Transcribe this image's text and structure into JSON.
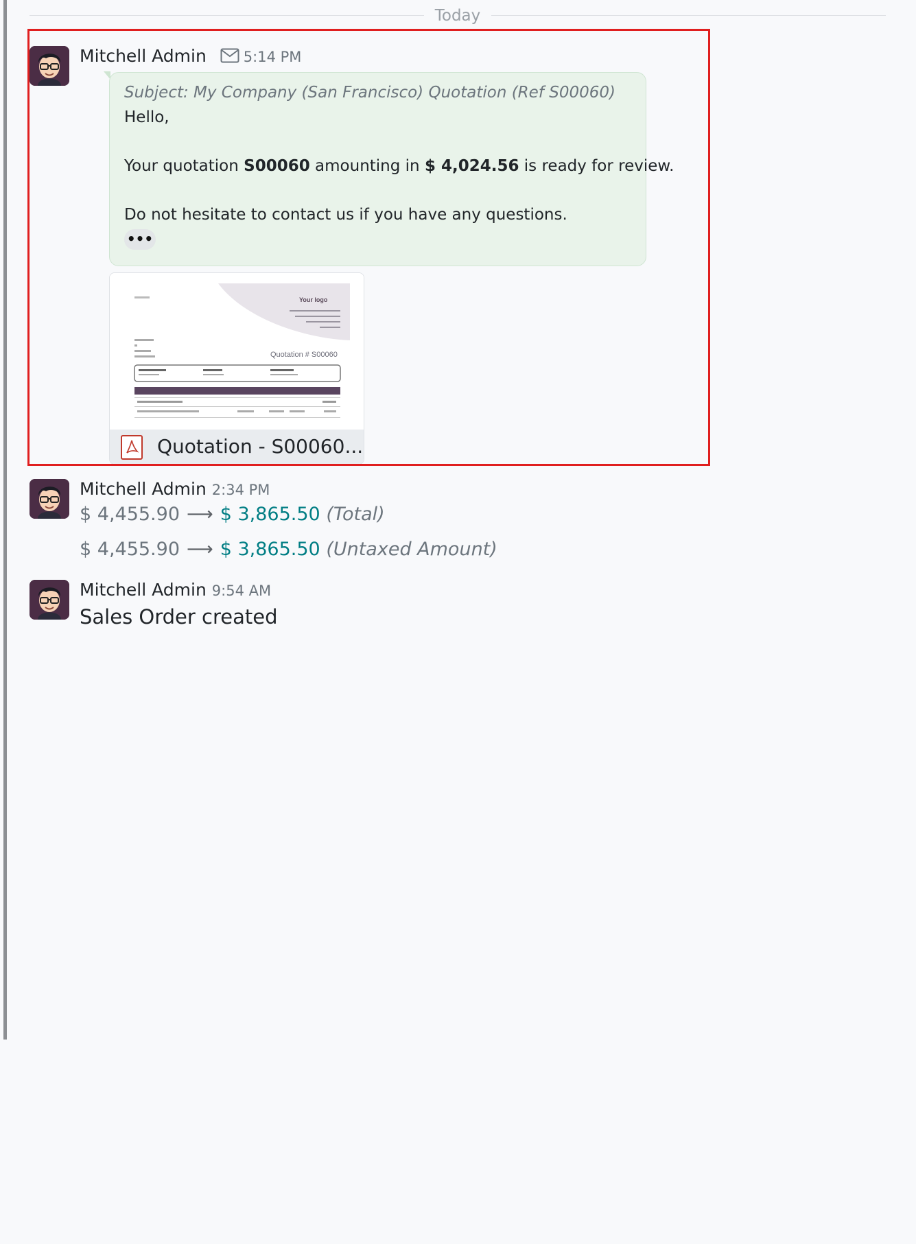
{
  "day_separator": "Today",
  "messages": [
    {
      "author": "Mitchell Admin",
      "time": "5:14 PM",
      "type": "email",
      "subject": "Subject: My Company (San Francisco) Quotation (Ref S00060)",
      "greeting": "Hello,",
      "line1_pre": "Your quotation ",
      "line1_ref": "S00060",
      "line1_mid": " amounting in ",
      "line1_amount": "$ 4,024.56",
      "line1_post": " is ready for review.",
      "line2": "Do not hesitate to contact us if you have any questions.",
      "more_label": "•••",
      "attachment": {
        "name": "Quotation - S00060...",
        "preview": {
          "logo": "Your logo",
          "title": "Quotation # S00060"
        }
      }
    },
    {
      "author": "Mitchell Admin",
      "time": "2:34 PM",
      "type": "tracking",
      "changes": [
        {
          "old": "$ 4,455.90",
          "new": "$ 3,865.50",
          "field": "(Total)"
        },
        {
          "old": "$ 4,455.90",
          "new": "$ 3,865.50",
          "field": "(Untaxed Amount)"
        }
      ]
    },
    {
      "author": "Mitchell Admin",
      "time": "9:54 AM",
      "type": "note",
      "body": "Sales Order created"
    }
  ],
  "colors": {
    "new_value": "#017e84",
    "highlight": "#e01f1f",
    "bubble": "#e9f3ea"
  },
  "icons": {
    "envelope": "envelope-icon",
    "pdf": "pdf-file-icon",
    "arrow": "long-arrow-right-icon"
  }
}
